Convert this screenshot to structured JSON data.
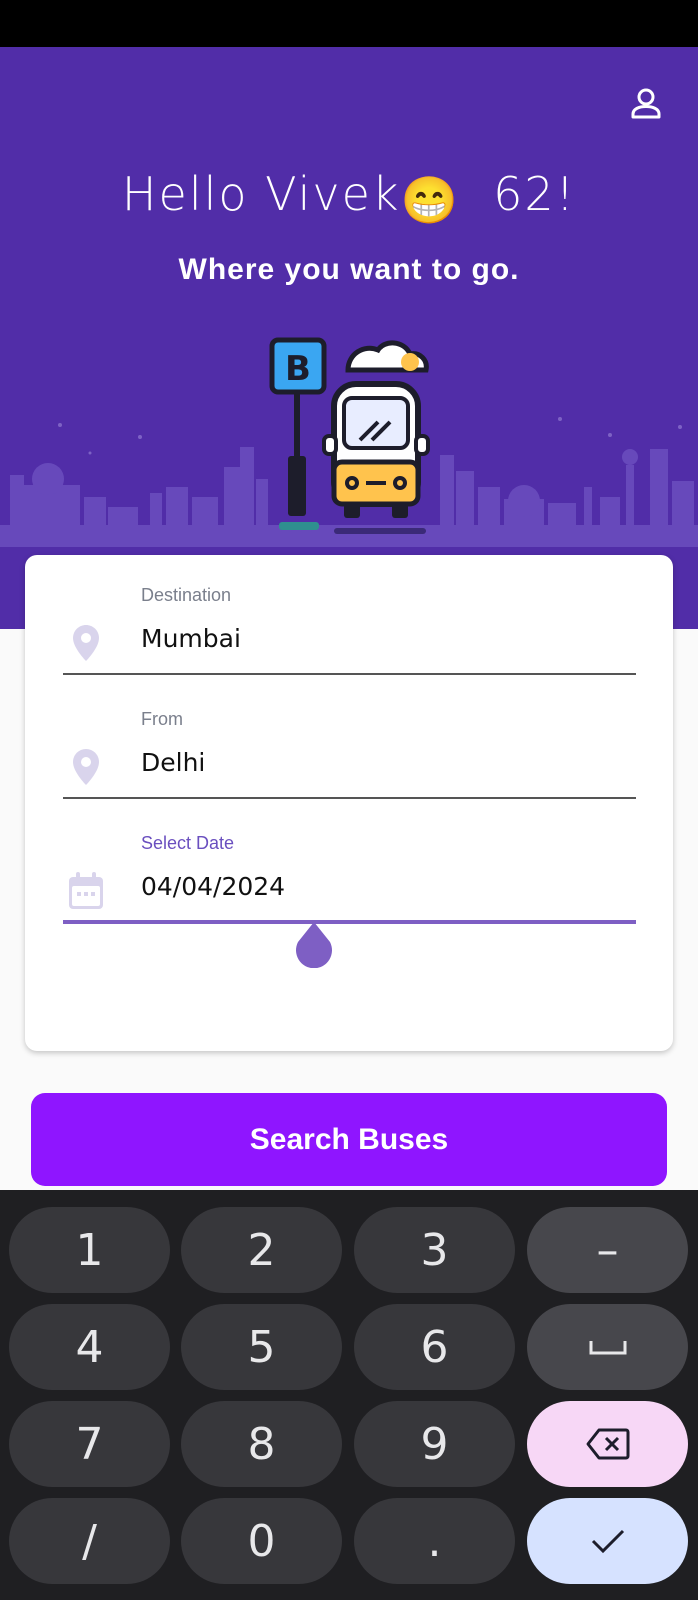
{
  "header": {
    "greeting_name": "Hello Vivek",
    "greeting_emoji": "😁",
    "greeting_number": "62!",
    "tagline": "Where you want to go.",
    "bus_stop_sign": "B",
    "profile_icon": "person-icon"
  },
  "form": {
    "destination": {
      "label": "Destination",
      "value": "Mumbai",
      "icon": "location-pin-icon"
    },
    "from": {
      "label": "From",
      "value": "Delhi",
      "icon": "location-pin-icon"
    },
    "date": {
      "label": "Select Date",
      "value": "04/04/2024",
      "icon": "calendar-icon"
    }
  },
  "search_button": {
    "label": "Search Buses"
  },
  "keyboard": {
    "keys": [
      "1",
      "2",
      "3",
      "–",
      "4",
      "5",
      "6",
      "␣",
      "7",
      "8",
      "9",
      "⌫",
      "/",
      "0",
      ".",
      "✓"
    ]
  },
  "colors": {
    "header_bg": "#512da8",
    "accent": "#7e5fc4",
    "button": "#8f15ff",
    "keyboard_bg": "#1f1f22"
  }
}
